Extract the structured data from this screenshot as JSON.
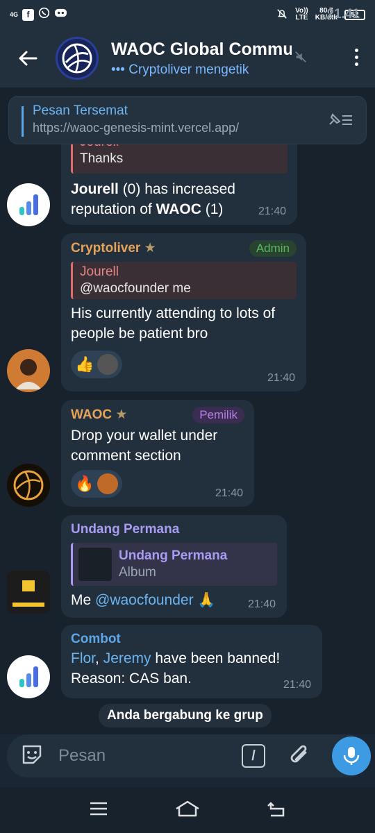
{
  "status_bar": {
    "network": "4G",
    "time": "21.41",
    "volte": "Vo))",
    "lte": "LTE",
    "speed": "80,7",
    "speed_unit": "KB/dtk",
    "battery": "52"
  },
  "header": {
    "title": "WAOC Global Commu",
    "subtitle": "••• Cryptoliver mengetik"
  },
  "pinned": {
    "title": "Pesan Tersemat",
    "link": "https://waoc-genesis-mint.vercel.app/"
  },
  "messages": [
    {
      "reply_name": "Jourell",
      "reply_text": "Thanks",
      "text_line1_bold": "Jourell",
      "text_line1_rest": " (0)  has increased",
      "text_line2_rest": "reputation of ",
      "text_line2_bold": "WAOC",
      "text_line2_end": " (1)",
      "time": "21:40"
    },
    {
      "sender": "Cryptoliver",
      "badge": "Admin",
      "reply_name": "Jourell",
      "reply_text": "@waocfounder me",
      "text": "His currently attending to lots of people be patient bro",
      "reaction1": "👍",
      "time": "21:40"
    },
    {
      "sender": "WAOC",
      "badge": "Pemilik",
      "text": "Drop your wallet under comment section",
      "reaction1": "🔥",
      "time": "21:40"
    },
    {
      "sender": "Undang Permana",
      "reply_name": "Undang Permana",
      "reply_text": "Album",
      "text": "Me ",
      "mention": "@waocfounder",
      "emoji": " 🙏",
      "time": "21:40"
    },
    {
      "sender": "Combot",
      "user1": "Flor",
      "sep": ", ",
      "user2": "Jeremy",
      "text_rest": " have been banned!",
      "reason": "Reason: CAS ban.",
      "time": "21:40"
    }
  ],
  "service_message": "Anda bergabung ke grup",
  "input": {
    "placeholder": "Pesan",
    "command": "/"
  },
  "colors": {
    "accent": "#3d9be3",
    "admin": "#58b85c",
    "owner": "#b580e6",
    "cryptoliver": "#e6a35a",
    "undang": "#a99cf2",
    "combot": "#5fa6e8"
  }
}
